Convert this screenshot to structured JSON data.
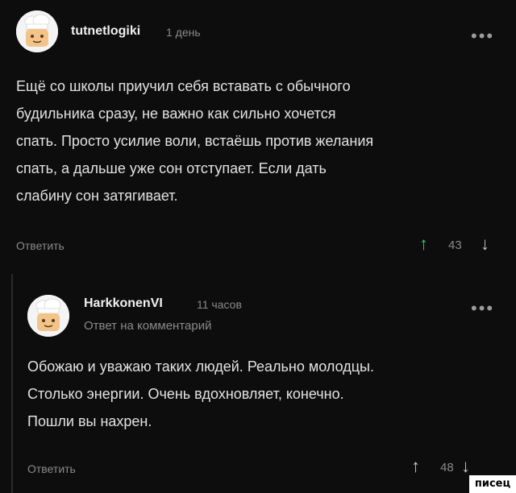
{
  "comments": [
    {
      "username": "tutnetlogiki",
      "time": "1 день",
      "body": [
        "Ещё со школы приучил себя вставать с обычного",
        "будильника сразу, не важно как сильно хочется",
        "спать. Просто усилие воли, встаёшь против желания",
        "спать, а дальше уже сон отступает. Если дать",
        "слабину сон затягивает."
      ],
      "reply_label": "Ответить",
      "score": "43",
      "upvoted": true
    },
    {
      "username": "HarkkonenVI",
      "time": "11 часов",
      "subline": "Ответ на комментарий",
      "body": [
        "Обожаю и уважаю таких людей. Реально молодцы.",
        "Столько энергии. Очень вдохновляет, конечно.",
        "Пошли вы нахрен."
      ],
      "reply_label": "Ответить",
      "score": "48",
      "upvoted": false
    }
  ],
  "icons": {
    "more": "•••",
    "up_arrow": "↑",
    "down_arrow": "↓"
  },
  "colors": {
    "background": "#0d0d0d",
    "upvote_active": "#3cc86a",
    "muted": "#8a8a8a"
  },
  "watermark": "писец"
}
